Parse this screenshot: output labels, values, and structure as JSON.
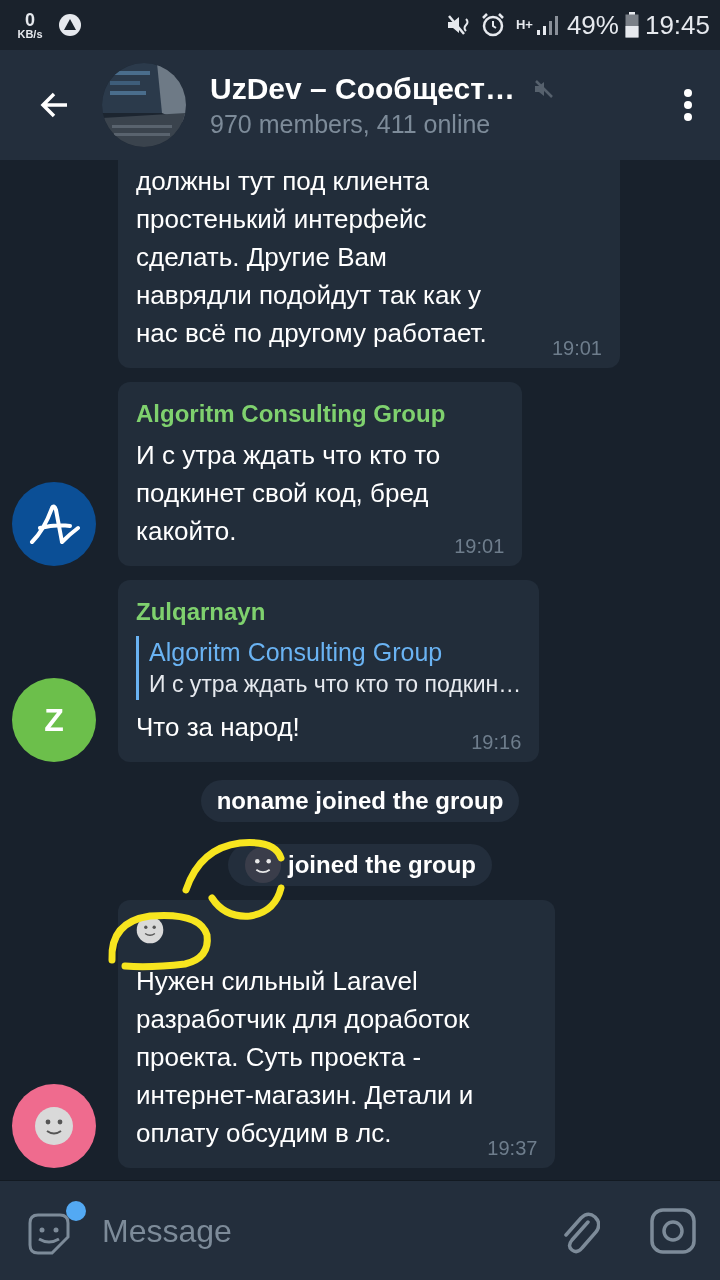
{
  "status_bar": {
    "speed_value": "0",
    "speed_unit": "KB/s",
    "network": "H+",
    "battery": "49%",
    "time": "19:45"
  },
  "header": {
    "title": "UzDev – Сообщест…",
    "subtitle": "970 members, 411 online",
    "muted": true
  },
  "messages": [
    {
      "kind": "message",
      "text": "должны тут под клиента\nпростенький интерфейс\nсделать. Другие Вам\nнаврядли подойдут так как у\nнас всё по другому работает.",
      "time": "19:01"
    },
    {
      "kind": "message",
      "sender": "Algoritm Consulting Group",
      "avatar": {
        "kind": "logo",
        "color": "#0b4f96"
      },
      "text": "И с утра ждать что кто то\nподкинет свой код, бред\nкакойто.",
      "time": "19:01"
    },
    {
      "kind": "message",
      "sender": "Zulqarnayn",
      "avatar": {
        "kind": "letter",
        "letter": "Z",
        "color": "#6cbf4b"
      },
      "reply": {
        "author": "Algoritm Consulting Group",
        "text": "И с утра ждать что кто то подкин…"
      },
      "text": "Что за народ!",
      "time": "19:16"
    },
    {
      "kind": "service",
      "text": "noname joined the group"
    },
    {
      "kind": "service_with_emoji",
      "text": "joined the group"
    },
    {
      "kind": "message_with_emoji",
      "avatar": {
        "kind": "emoji",
        "color": "#ef6b8e"
      },
      "text": "Нужен сильный Laravel\nразработчик для доработок\nпроекта. Суть проекта -\nинтернет-магазин. Детали и\nоплату обсудим в лс.",
      "time": "19:37"
    }
  ],
  "composer": {
    "placeholder": "Message",
    "sticker_badge": true
  }
}
